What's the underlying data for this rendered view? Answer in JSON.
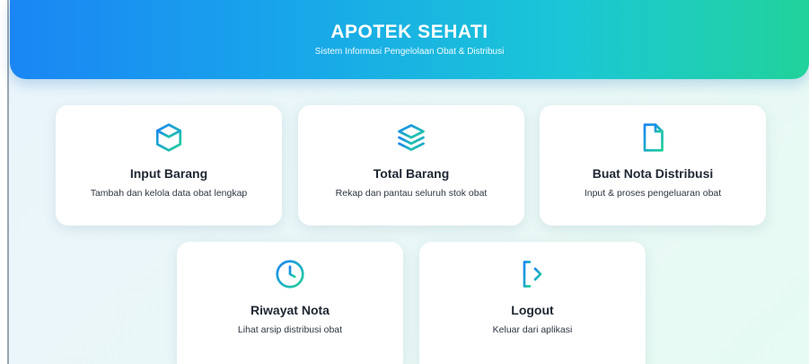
{
  "header": {
    "title": "APOTEK SEHATI",
    "subtitle": "Sistem Informasi Pengelolaan Obat & Distribusi"
  },
  "menu": [
    {
      "icon": "box-icon",
      "title": "Input Barang",
      "description": "Tambah dan kelola data obat lengkap"
    },
    {
      "icon": "layers-icon",
      "title": "Total Barang",
      "description": "Rekap dan pantau seluruh stok obat"
    },
    {
      "icon": "document-icon",
      "title": "Buat Nota Distribusi",
      "description": "Input & proses pengeluaran obat"
    },
    {
      "icon": "clock-icon",
      "title": "Riwayat Nota",
      "description": "Lihat arsip distribusi obat"
    },
    {
      "icon": "logout-icon",
      "title": "Logout",
      "description": "Keluar dari aplikasi"
    }
  ],
  "colors": {
    "gradient_start": "#1a86f4",
    "gradient_end": "#21d29a"
  }
}
